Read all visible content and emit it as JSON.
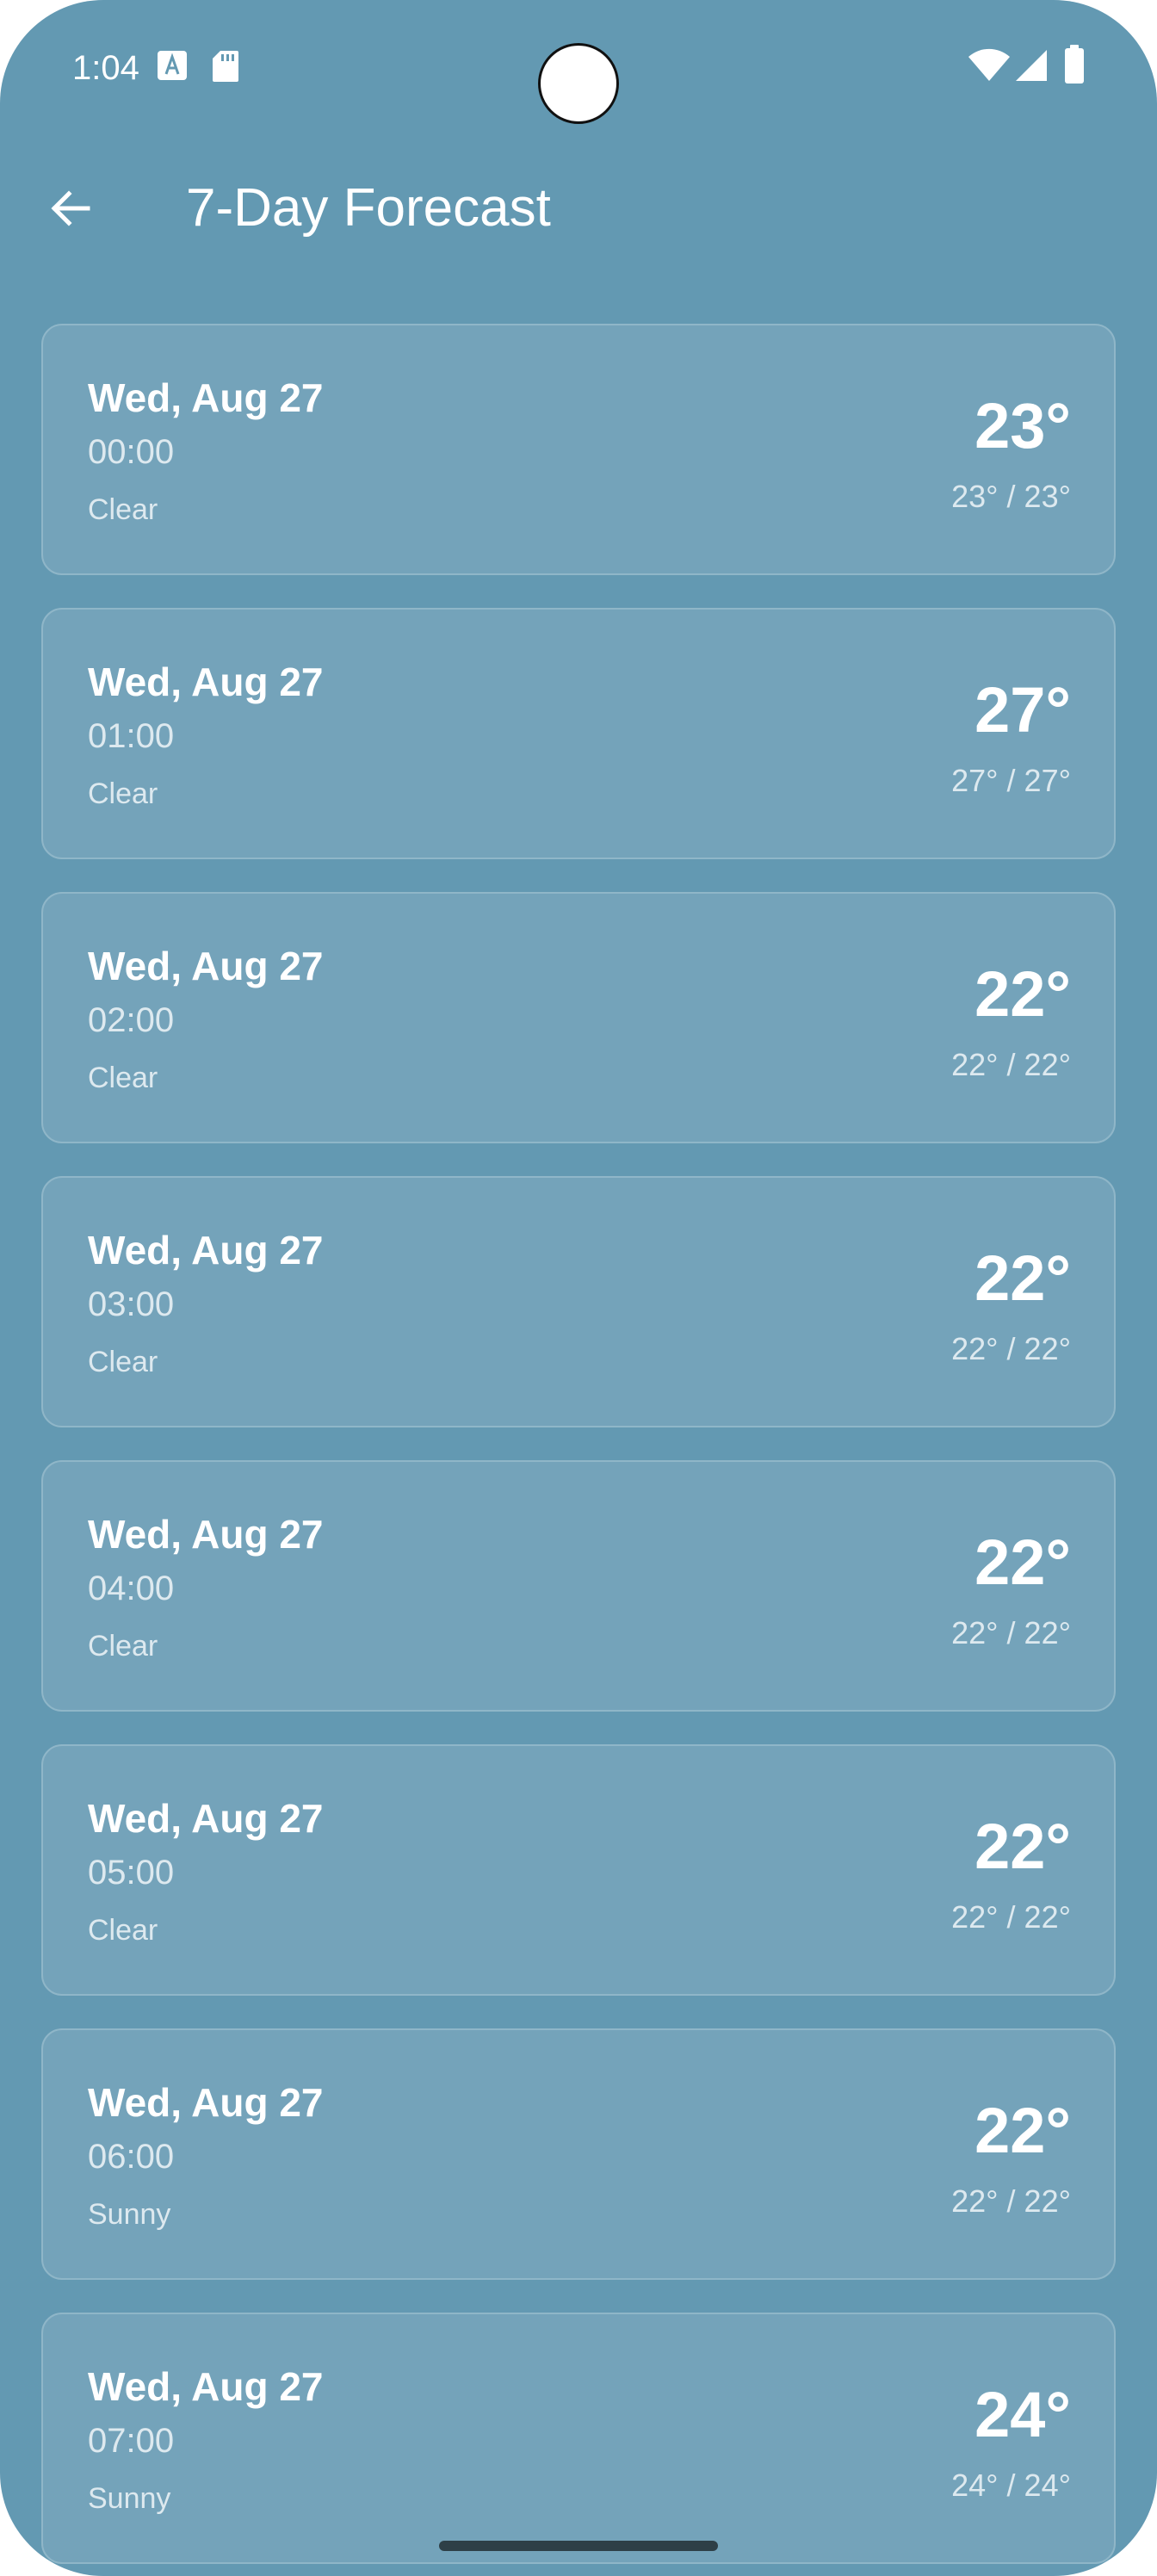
{
  "status_bar": {
    "time": "1:04",
    "left_icons": [
      "font-accessibility-icon",
      "sd-card-icon"
    ],
    "right_icons": [
      "wifi-icon",
      "cellular-signal-icon",
      "battery-icon"
    ]
  },
  "app_bar": {
    "back_icon": "arrow-back-icon",
    "title": "7-Day Forecast"
  },
  "colors": {
    "background": "#6399b2",
    "card": "#74a3ba",
    "card_border": "#8fb6c8",
    "primary_text": "#ffffff",
    "secondary_text": "#dde9ef"
  },
  "forecast": [
    {
      "date": "Wed, Aug 27",
      "time": "00:00",
      "condition": "Clear",
      "temp": "23°",
      "range": "23° / 23°"
    },
    {
      "date": "Wed, Aug 27",
      "time": "01:00",
      "condition": "Clear",
      "temp": "27°",
      "range": "27° / 27°"
    },
    {
      "date": "Wed, Aug 27",
      "time": "02:00",
      "condition": "Clear",
      "temp": "22°",
      "range": "22° / 22°"
    },
    {
      "date": "Wed, Aug 27",
      "time": "03:00",
      "condition": "Clear",
      "temp": "22°",
      "range": "22° / 22°"
    },
    {
      "date": "Wed, Aug 27",
      "time": "04:00",
      "condition": "Clear",
      "temp": "22°",
      "range": "22° / 22°"
    },
    {
      "date": "Wed, Aug 27",
      "time": "05:00",
      "condition": "Clear",
      "temp": "22°",
      "range": "22° / 22°"
    },
    {
      "date": "Wed, Aug 27",
      "time": "06:00",
      "condition": "Sunny",
      "temp": "22°",
      "range": "22° / 22°"
    },
    {
      "date": "Wed, Aug 27",
      "time": "07:00",
      "condition": "Sunny",
      "temp": "24°",
      "range": "24° / 24°"
    }
  ]
}
